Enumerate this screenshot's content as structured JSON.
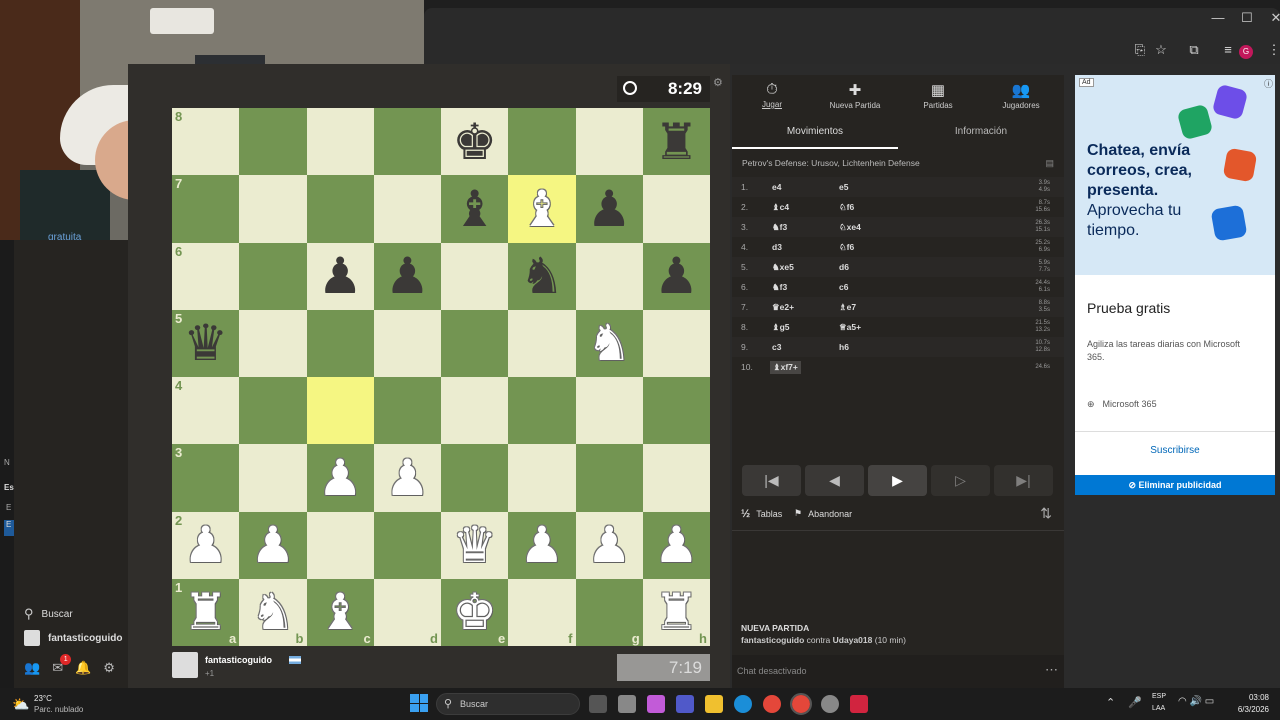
{
  "webcam": {
    "overlay_text": "gratuita"
  },
  "sidebar": {
    "search_label": "Buscar",
    "username": "fantasticoguido",
    "notif_count": "1",
    "left_letters": [
      "N",
      "Es",
      "E",
      "E"
    ]
  },
  "game": {
    "top_clock": "8:29",
    "bottom_clock": "7:19",
    "bottom_player": {
      "name": "fantasticoguido",
      "rating_diff": "+1"
    },
    "board": [
      [
        "",
        "",
        "",
        "",
        "k",
        "",
        "",
        "r"
      ],
      [
        "",
        "",
        "",
        "",
        "b",
        "B",
        "p",
        ""
      ],
      [
        "",
        "",
        "p",
        "p",
        "",
        "n",
        "",
        "p"
      ],
      [
        "q",
        "",
        "",
        "",
        "",
        "",
        "N",
        ""
      ],
      [
        "",
        "",
        "",
        "",
        "",
        "",
        "",
        ""
      ],
      [
        "",
        "",
        "P",
        "P",
        "",
        "",
        "",
        ""
      ],
      [
        "P",
        "P",
        "",
        "",
        "Q",
        "P",
        "P",
        "P"
      ],
      [
        "R",
        "N",
        "B",
        "",
        "K",
        "",
        "",
        "R"
      ]
    ],
    "ranks": [
      "8",
      "7",
      "6",
      "5",
      "4",
      "3",
      "2",
      "1"
    ],
    "files": [
      "a",
      "b",
      "c",
      "d",
      "e",
      "f",
      "g",
      "h"
    ]
  },
  "panel": {
    "nav_tabs": [
      {
        "label": "Jugar",
        "icon": "stopwatch-icon",
        "glyph": "⏱"
      },
      {
        "label": "Nueva Partida",
        "icon": "plus-icon",
        "glyph": "✚"
      },
      {
        "label": "Partidas",
        "icon": "board-icon",
        "glyph": "▦"
      },
      {
        "label": "Jugadores",
        "icon": "players-icon",
        "glyph": "👥"
      }
    ],
    "sub_tabs": [
      "Movimientos",
      "Información"
    ],
    "opening": "Petrov's Defense: Urusov, Lichtenhein Defense",
    "moves": [
      {
        "n": "1.",
        "w": "e4",
        "b": "e5",
        "tw": "3.9s",
        "tb": "4.9s"
      },
      {
        "n": "2.",
        "w": "♝c4",
        "b": "♘f6",
        "tw": "8.7s",
        "tb": "15.6s"
      },
      {
        "n": "3.",
        "w": "♞f3",
        "b": "♘xe4",
        "tw": "26.3s",
        "tb": "15.1s"
      },
      {
        "n": "4.",
        "w": "d3",
        "b": "♘f6",
        "tw": "25.2s",
        "tb": "6.9s"
      },
      {
        "n": "5.",
        "w": "♞xe5",
        "b": "d6",
        "tw": "5.9s",
        "tb": "7.7s"
      },
      {
        "n": "6.",
        "w": "♞f3",
        "b": "c6",
        "tw": "24.4s",
        "tb": "6.1s"
      },
      {
        "n": "7.",
        "w": "♛e2+",
        "b": "♗e7",
        "tw": "8.8s",
        "tb": "3.5s"
      },
      {
        "n": "8.",
        "w": "♝g5",
        "b": "♕a5+",
        "tw": "21.5s",
        "tb": "13.2s"
      },
      {
        "n": "9.",
        "w": "c3",
        "b": "h6",
        "tw": "10.7s",
        "tb": "12.8s"
      },
      {
        "n": "10.",
        "w": "♝xf7+",
        "b": "",
        "tw": "24.6s",
        "tb": ""
      }
    ],
    "draw_label": "Tablas",
    "resign_label": "Abandonar",
    "new_game_title": "NUEVA PARTIDA",
    "game_player": "fantasticoguido",
    "game_versus": "contra",
    "game_opponent": "Udaya018",
    "game_timectl": "(10 min)",
    "chat_disabled": "Chat desactivado"
  },
  "ad": {
    "badge": "Ad",
    "headline_bold": "Chatea, envía correos, crea, presenta.",
    "headline_light": "Aprovecha tu tiempo.",
    "title": "Prueba gratis",
    "desc": "Agiliza las tareas diarias con Microsoft 365.",
    "source": "Microsoft 365",
    "cta": "Suscribirse",
    "remove": "Eliminar publicidad"
  },
  "taskbar": {
    "temp": "23°C",
    "weather": "Parc. nublado",
    "search": "Buscar",
    "lang1": "ESP",
    "lang2": "LAA",
    "time": "03:08",
    "date": "6/3/2026"
  },
  "colors": {
    "board_light": "#ebecd0",
    "board_dark": "#739552",
    "highlight": "#f5f682",
    "ad_blue": "#0078d4"
  }
}
